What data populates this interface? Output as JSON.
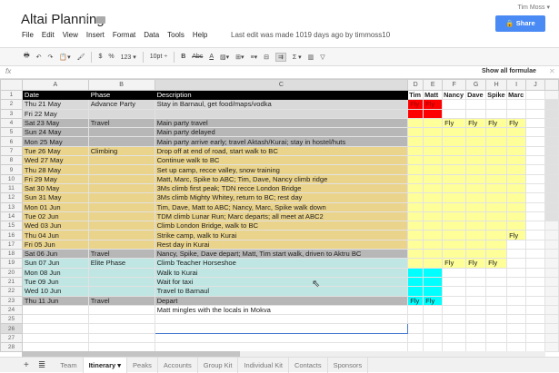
{
  "header": {
    "title": "Altai Planning",
    "user": "Tim Moss ▾",
    "share": "Share",
    "last_edit": "Last edit was made 1019 days ago by timmoss10"
  },
  "menu": [
    "File",
    "Edit",
    "View",
    "Insert",
    "Format",
    "Data",
    "Tools",
    "Help"
  ],
  "toolbar": {
    "currency": "$",
    "percent": "%",
    "number_format": "123 ▾",
    "font_size": "10pt ÷",
    "bold": "B",
    "strike": "Abc",
    "text_color": "A",
    "sum": "Σ ▾"
  },
  "formula_bar": {
    "fx": "fx",
    "value": "",
    "show_all_formulas": "Show all formulae"
  },
  "columns": [
    "A",
    "B",
    "C",
    "D",
    "E",
    "F",
    "G",
    "H",
    "I",
    "J"
  ],
  "colors": {
    "grey_light": "#d9d9d9",
    "grey_dark": "#b7b7b7",
    "climb": "#ead38a",
    "elite": "#bfe6e3",
    "yellow": "#ffff99",
    "red": "#ff0000",
    "cyan": "#00ffff"
  },
  "rows": [
    {
      "n": "1",
      "A": "Date",
      "B": "Phase",
      "C": "Description",
      "D": "Tim",
      "E": "Matt",
      "F": "Nancy",
      "G": "Dave",
      "H": "Spike",
      "I": "Marc"
    },
    {
      "n": "2",
      "A": "Thu 21 May",
      "B": "Advance Party",
      "C": "Stay in Barnaul, get food/maps/vodka",
      "D": "Fly",
      "E": "Fly"
    },
    {
      "n": "3",
      "A": "Fri 22 May"
    },
    {
      "n": "4",
      "A": "Sat 23 May",
      "B": "Travel",
      "C": "Main party travel",
      "F": "Fly",
      "G": "Fly",
      "H": "Fly",
      "I": "Fly"
    },
    {
      "n": "5",
      "A": "Sun 24 May",
      "C": "Main party delayed"
    },
    {
      "n": "6",
      "A": "Mon 25 May",
      "C": "Main party arrive early; travel Aktash/Kurai; stay in hostel/huts"
    },
    {
      "n": "7",
      "A": "Tue 26 May",
      "B": "Climbing",
      "C": "Drop off at end of road, start walk to BC"
    },
    {
      "n": "8",
      "A": "Wed 27 May",
      "C": "Continue walk to BC"
    },
    {
      "n": "9",
      "A": "Thu 28 May",
      "C": "Set up camp, recce valley, snow training"
    },
    {
      "n": "10",
      "A": "Fri 29 May",
      "C": "Matt, Marc, Spike to ABC; Tim, Dave, Nancy climb ridge"
    },
    {
      "n": "11",
      "A": "Sat 30 May",
      "C": "3Ms climb first peak; TDN recce London Bridge"
    },
    {
      "n": "12",
      "A": "Sun 31 May",
      "C": "3Ms climb Mighty Whitey, return to BC; rest day"
    },
    {
      "n": "13",
      "A": "Mon 01 Jun",
      "C": "Tim, Dave, Matt to ABC; Nancy, Marc, Spike walk down"
    },
    {
      "n": "14",
      "A": "Tue 02 Jun",
      "C": "TDM climb Lunar Run; Marc departs; all meet at ABC2"
    },
    {
      "n": "15",
      "A": "Wed 03 Jun",
      "C": "Climb London Bridge, walk to BC"
    },
    {
      "n": "16",
      "A": "Thu 04 Jun",
      "C": "Strike camp, walk to Kurai",
      "I": "Fly"
    },
    {
      "n": "17",
      "A": "Fri 05 Jun",
      "C": "Rest day in Kurai"
    },
    {
      "n": "18",
      "A": "Sat 06 Jun",
      "B": "Travel",
      "C": "Nancy, Spike, Dave depart; Matt, Tim start walk, driven to Aktru BC"
    },
    {
      "n": "19",
      "A": "Sun 07 Jun",
      "B": "Elite Phase",
      "C": "Climb Teacher Horseshoe",
      "F": "Fly",
      "G": "Fly",
      "H": "Fly"
    },
    {
      "n": "20",
      "A": "Mon 08 Jun",
      "C": "Walk to Kurai"
    },
    {
      "n": "21",
      "A": "Tue 09 Jun",
      "C": "Wait for taxi"
    },
    {
      "n": "22",
      "A": "Wed 10 Jun",
      "C": "Travel to Barnaul"
    },
    {
      "n": "23",
      "A": "Thu 11 Jun",
      "B": "Travel",
      "C": "Depart",
      "D": "Fly",
      "E": "Fly"
    },
    {
      "n": "24",
      "C": "Matt mingles with the locals in Mokva"
    },
    {
      "n": "25"
    },
    {
      "n": "26"
    },
    {
      "n": "27"
    },
    {
      "n": "28"
    }
  ],
  "sheet_tabs": [
    "Team",
    "Itinerary ▾",
    "Peaks",
    "Accounts",
    "Group Kit",
    "Individual Kit",
    "Contacts",
    "Sponsors"
  ],
  "active_tab": 1
}
